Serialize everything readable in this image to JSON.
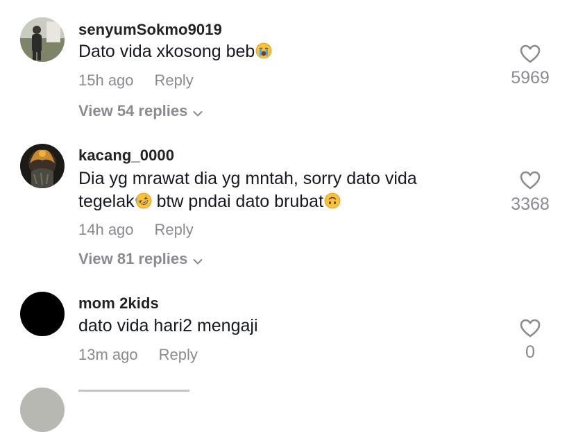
{
  "colors": {
    "text": "#161823",
    "muted": "#8a8b91",
    "background": "#ffffff"
  },
  "comments": [
    {
      "username": "senyumSokmo9019",
      "text": "Dato vida xkosong beb",
      "emoji": [
        "loudly-crying-face"
      ],
      "time": "15h ago",
      "reply_label": "Reply",
      "view_replies": "View 54 replies",
      "likes": "5969",
      "avatar": "photo-person-standing"
    },
    {
      "username": "kacang_0000",
      "text_line1": "Dia yg mrawat dia yg mntah, sorry dato vida",
      "text_line2_a": "tegelak",
      "text_line2_b": " btw pndai dato brubat",
      "emoji": [
        "rolling-on-floor-laughing-face",
        "upside-down-face"
      ],
      "time": "14h ago",
      "reply_label": "Reply",
      "view_replies": "View 81 replies",
      "likes": "3368",
      "avatar": "photo-dark-crown"
    },
    {
      "username": "mom 2kids",
      "text": "dato vida hari2 mengaji",
      "time": "13m ago",
      "reply_label": "Reply",
      "likes": "0",
      "avatar": "black-circle"
    }
  ],
  "icons": {
    "like": "heart-outline-icon",
    "expand": "chevron-down-icon"
  }
}
